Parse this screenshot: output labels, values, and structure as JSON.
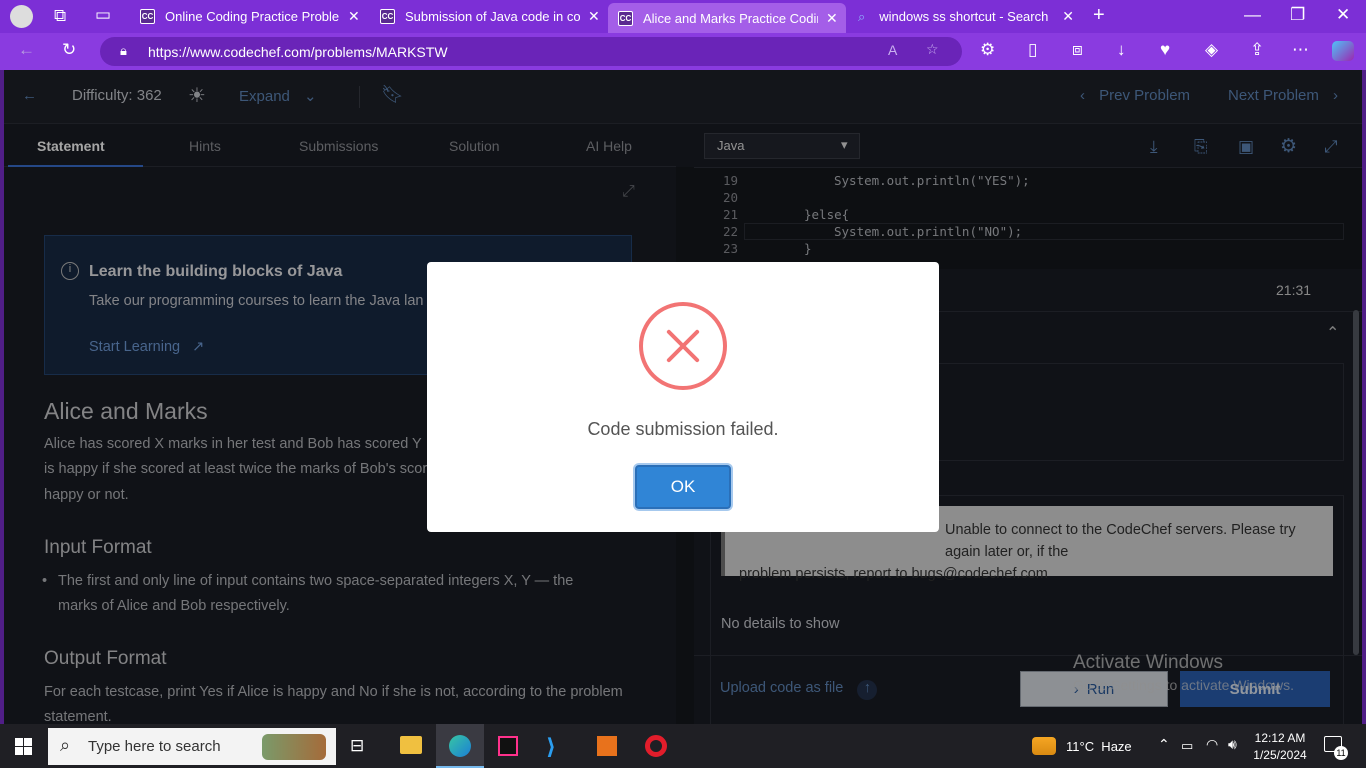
{
  "browser": {
    "tabs": [
      {
        "label": "Online Coding Practice Problems",
        "favicon": "CC",
        "active": false
      },
      {
        "label": "Submission of Java code in code",
        "favicon": "CC",
        "active": false
      },
      {
        "label": "Alice and Marks Practice Coding",
        "favicon": "CC",
        "active": true
      },
      {
        "label": "windows ss shortcut - Search",
        "favicon": "search-icon",
        "active": false
      }
    ],
    "url": "https://www.codechef.com/problems/MARKSTW"
  },
  "topbar": {
    "difficulty": "Difficulty: 362",
    "expand": "Expand",
    "prev": "Prev Problem",
    "next": "Next Problem"
  },
  "panel_tabs": [
    "Statement",
    "Hints",
    "Submissions",
    "Solution",
    "AI Help"
  ],
  "learn": {
    "title": "Learn the building blocks of Java",
    "text": "Take our programming courses to learn the Java lan",
    "cta": "Start Learning"
  },
  "problem": {
    "title": "Alice and Marks",
    "line1": "Alice has scored X marks in her test and Bob has scored Y",
    "line2": "is happy if she scored at least twice the marks of Bob's scor",
    "line3": "happy or not.",
    "input_heading": "Input Format",
    "input_text1": "The first and only line of input contains two space-separated integers X, Y — the",
    "input_text2": "marks of Alice and Bob respectively.",
    "output_heading": "Output Format",
    "output_text": "For each testcase, print Yes if Alice is happy and No if she is not, according to the problem",
    "output_text2": "statement."
  },
  "editor": {
    "language": "Java",
    "lines": [
      {
        "n": "19",
        "code": "System.out.println(\"YES\");"
      },
      {
        "n": "20",
        "code": ""
      },
      {
        "n": "21",
        "code": "}else{"
      },
      {
        "n": "22",
        "code": "System.out.println(\"NO\");"
      },
      {
        "n": "23",
        "code": "}"
      }
    ],
    "cursor_pos": "21:31",
    "status_text1": "Unable to connect to the CodeChef servers. Please try again later or, if the",
    "status_text2": "problem persists, report to bugs@codechef.com",
    "no_details": "No details to show",
    "upload": "Upload code as file",
    "run": "Run",
    "submit": "Submit"
  },
  "watermark": {
    "title": "Activate Windows",
    "sub": "Go to Settings to activate Windows."
  },
  "modal": {
    "message": "Code submission failed.",
    "ok": "OK"
  },
  "taskbar": {
    "search_placeholder": "Type here to search",
    "weather": "11°C  Haze",
    "time": "12:12 AM",
    "date": "1/25/2024",
    "notif_count": "11"
  },
  "colors": {
    "error": "#f27474",
    "ok_button": "#3085d6",
    "browser_purple": "#7c2fd6"
  }
}
